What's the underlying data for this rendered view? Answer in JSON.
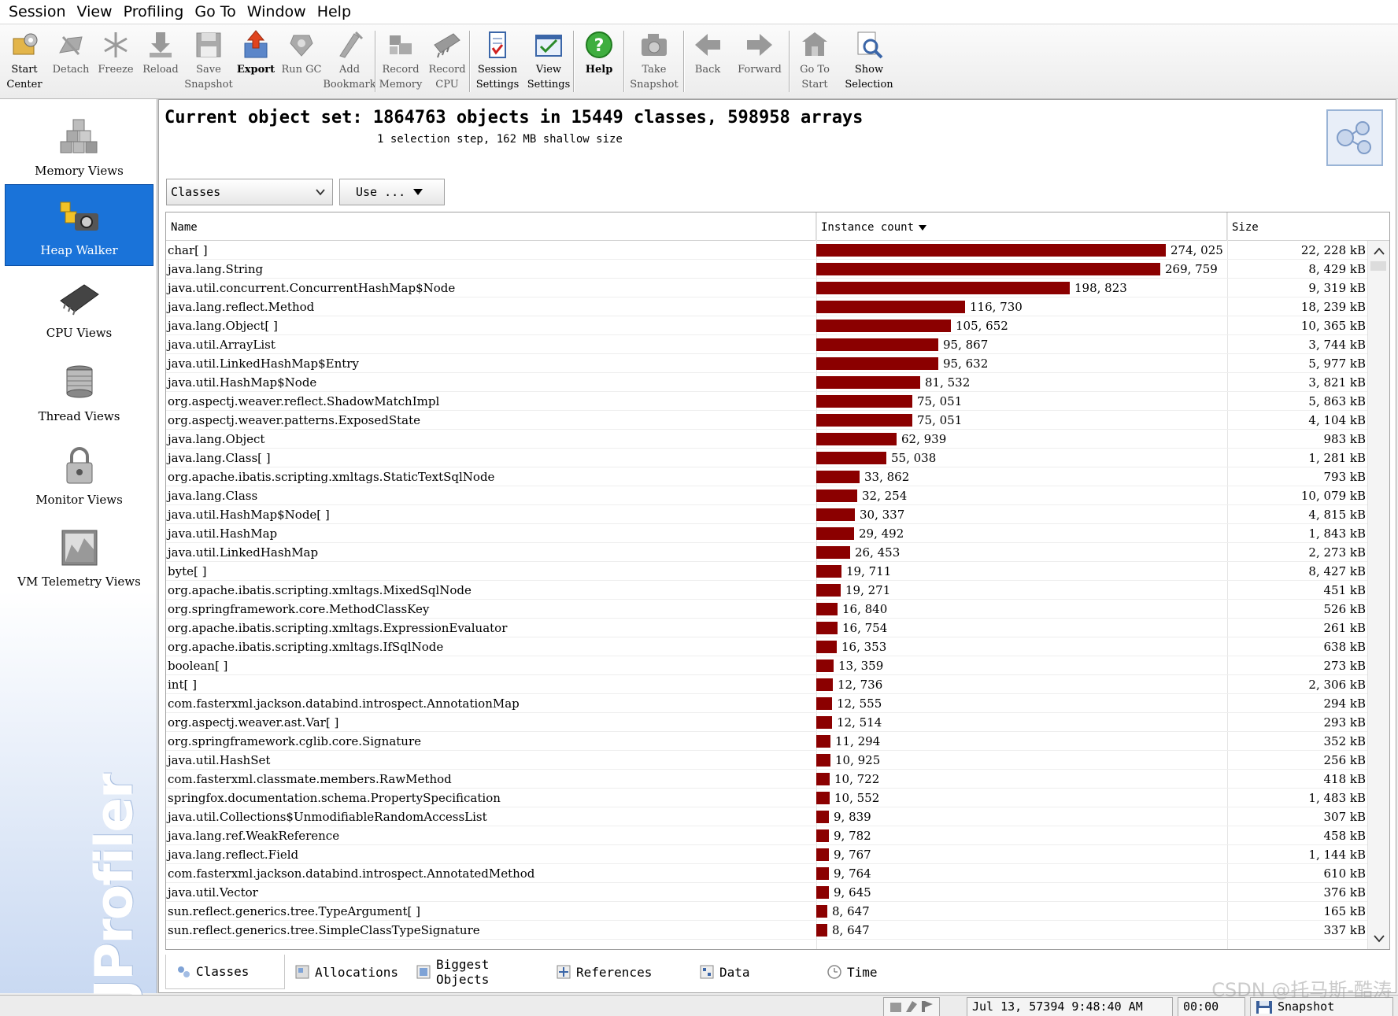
{
  "menu": [
    "Session",
    "View",
    "Profiling",
    "Go To",
    "Window",
    "Help"
  ],
  "toolbar": [
    {
      "id": "start-center",
      "label": "Start\nCenter",
      "style": "darknb",
      "icon": "start-center-icon"
    },
    {
      "id": "detach",
      "label": "Detach",
      "style": "",
      "icon": "detach-icon"
    },
    {
      "id": "freeze",
      "label": "Freeze",
      "style": "",
      "icon": "freeze-icon"
    },
    {
      "id": "reload",
      "label": "Reload",
      "style": "",
      "icon": "reload-icon"
    },
    {
      "id": "save-snapshot",
      "label": "Save\nSnapshot",
      "style": "",
      "icon": "save-icon"
    },
    {
      "id": "export",
      "label": "Export",
      "style": "dark",
      "icon": "export-icon"
    },
    {
      "id": "run-gc",
      "label": "Run GC",
      "style": "",
      "icon": "run-gc-icon"
    },
    {
      "id": "add-bookmark",
      "label": "Add\nBookmark",
      "style": "",
      "icon": "bookmark-icon",
      "sep_after": true
    },
    {
      "id": "record-memory",
      "label": "Record\nMemory",
      "style": "",
      "icon": "record-memory-icon"
    },
    {
      "id": "record-cpu",
      "label": "Record\nCPU",
      "style": "",
      "icon": "record-cpu-icon",
      "sep_after": true
    },
    {
      "id": "session-settings",
      "label": "Session\nSettings",
      "style": "darknb",
      "icon": "session-settings-icon"
    },
    {
      "id": "view-settings",
      "label": "View\nSettings",
      "style": "darknb",
      "icon": "view-settings-icon",
      "sep_after": true
    },
    {
      "id": "help",
      "label": "Help",
      "style": "dark",
      "icon": "help-icon",
      "sep_after": true
    },
    {
      "id": "take-snapshot",
      "label": "Take\nSnapshot",
      "style": "",
      "icon": "camera-icon",
      "sep_after": true
    },
    {
      "id": "back",
      "label": "Back",
      "style": "",
      "icon": "back-arrow-icon"
    },
    {
      "id": "forward",
      "label": "Forward",
      "style": "",
      "icon": "forward-arrow-icon",
      "sep_after": true
    },
    {
      "id": "go-to-start",
      "label": "Go To\nStart",
      "style": "",
      "icon": "go-to-start-icon"
    },
    {
      "id": "show-selection",
      "label": "Show\nSelection",
      "style": "darknb",
      "icon": "show-selection-icon"
    }
  ],
  "sidebar": [
    {
      "id": "memory-views",
      "label": "Memory Views",
      "icon": "memory-views-icon",
      "active": false
    },
    {
      "id": "heap-walker",
      "label": "Heap Walker",
      "icon": "heap-walker-icon",
      "active": true
    },
    {
      "id": "cpu-views",
      "label": "CPU Views",
      "icon": "cpu-chip-icon",
      "active": false
    },
    {
      "id": "thread-views",
      "label": "Thread Views",
      "icon": "thread-spool-icon",
      "active": false
    },
    {
      "id": "monitor-views",
      "label": "Monitor Views",
      "icon": "lock-icon",
      "active": false
    },
    {
      "id": "vm-telemetry-views",
      "label": "VM Telemetry Views",
      "icon": "telemetry-chart-icon",
      "active": false
    }
  ],
  "logo_text": "JProfiler",
  "header": {
    "title": "Current object set: 1864763 objects in 15449 classes, 598958 arrays",
    "subtitle": "1 selection step, 162 MB shallow size"
  },
  "controls": {
    "view_select": "Classes",
    "use_button": "Use ..."
  },
  "table": {
    "columns": [
      "Name",
      "Instance count",
      "Size"
    ],
    "max_count": 274025,
    "rows": [
      {
        "name": "char[ ]",
        "count": 274025,
        "count_label": "274, 025",
        "size": "22, 228  kB"
      },
      {
        "name": "java.lang.String",
        "count": 269759,
        "count_label": "269, 759",
        "size": "8, 429  kB"
      },
      {
        "name": "java.util.concurrent.ConcurrentHashMap$Node",
        "count": 198823,
        "count_label": "198, 823",
        "size": "9, 319  kB"
      },
      {
        "name": "java.lang.reflect.Method",
        "count": 116730,
        "count_label": "116, 730",
        "size": "18, 239  kB"
      },
      {
        "name": "java.lang.Object[ ]",
        "count": 105652,
        "count_label": "105, 652",
        "size": "10, 365  kB"
      },
      {
        "name": "java.util.ArrayList",
        "count": 95867,
        "count_label": "95, 867",
        "size": "3, 744  kB"
      },
      {
        "name": "java.util.LinkedHashMap$Entry",
        "count": 95632,
        "count_label": "95, 632",
        "size": "5, 977  kB"
      },
      {
        "name": "java.util.HashMap$Node",
        "count": 81532,
        "count_label": "81, 532",
        "size": "3, 821  kB"
      },
      {
        "name": "org.aspectj.weaver.reflect.ShadowMatchImpl",
        "count": 75051,
        "count_label": "75, 051",
        "size": "5, 863  kB"
      },
      {
        "name": "org.aspectj.weaver.patterns.ExposedState",
        "count": 75051,
        "count_label": "75, 051",
        "size": "4, 104  kB"
      },
      {
        "name": "java.lang.Object",
        "count": 62939,
        "count_label": "62, 939",
        "size": "983  kB"
      },
      {
        "name": "java.lang.Class[ ]",
        "count": 55038,
        "count_label": "55, 038",
        "size": "1, 281  kB"
      },
      {
        "name": "org.apache.ibatis.scripting.xmltags.StaticTextSqlNode",
        "count": 33862,
        "count_label": "33, 862",
        "size": "793  kB"
      },
      {
        "name": "java.lang.Class",
        "count": 32254,
        "count_label": "32, 254",
        "size": "10, 079  kB"
      },
      {
        "name": "java.util.HashMap$Node[ ]",
        "count": 30337,
        "count_label": "30, 337",
        "size": "4, 815  kB"
      },
      {
        "name": "java.util.HashMap",
        "count": 29492,
        "count_label": "29, 492",
        "size": "1, 843  kB"
      },
      {
        "name": "java.util.LinkedHashMap",
        "count": 26453,
        "count_label": "26, 453",
        "size": "2, 273  kB"
      },
      {
        "name": "byte[ ]",
        "count": 19711,
        "count_label": "19, 711",
        "size": "8, 427  kB"
      },
      {
        "name": "org.apache.ibatis.scripting.xmltags.MixedSqlNode",
        "count": 19271,
        "count_label": "19, 271",
        "size": "451  kB"
      },
      {
        "name": "org.springframework.core.MethodClassKey",
        "count": 16840,
        "count_label": "16, 840",
        "size": "526  kB"
      },
      {
        "name": "org.apache.ibatis.scripting.xmltags.ExpressionEvaluator",
        "count": 16754,
        "count_label": "16, 754",
        "size": "261  kB"
      },
      {
        "name": "org.apache.ibatis.scripting.xmltags.IfSqlNode",
        "count": 16353,
        "count_label": "16, 353",
        "size": "638  kB"
      },
      {
        "name": "boolean[ ]",
        "count": 13359,
        "count_label": "13, 359",
        "size": "273  kB"
      },
      {
        "name": "int[ ]",
        "count": 12736,
        "count_label": "12, 736",
        "size": "2, 306  kB"
      },
      {
        "name": "com.fasterxml.jackson.databind.introspect.AnnotationMap",
        "count": 12555,
        "count_label": "12, 555",
        "size": "294  kB"
      },
      {
        "name": "org.aspectj.weaver.ast.Var[ ]",
        "count": 12514,
        "count_label": "12, 514",
        "size": "293  kB"
      },
      {
        "name": "org.springframework.cglib.core.Signature",
        "count": 11294,
        "count_label": "11, 294",
        "size": "352  kB"
      },
      {
        "name": "java.util.HashSet",
        "count": 10925,
        "count_label": "10, 925",
        "size": "256  kB"
      },
      {
        "name": "com.fasterxml.classmate.members.RawMethod",
        "count": 10722,
        "count_label": "10, 722",
        "size": "418  kB"
      },
      {
        "name": "springfox.documentation.schema.PropertySpecification",
        "count": 10552,
        "count_label": "10, 552",
        "size": "1, 483  kB"
      },
      {
        "name": "java.util.Collections$UnmodifiableRandomAccessList",
        "count": 9839,
        "count_label": "9, 839",
        "size": "307  kB"
      },
      {
        "name": "java.lang.ref.WeakReference",
        "count": 9782,
        "count_label": "9, 782",
        "size": "458  kB"
      },
      {
        "name": "java.lang.reflect.Field",
        "count": 9767,
        "count_label": "9, 767",
        "size": "1, 144  kB"
      },
      {
        "name": "com.fasterxml.jackson.databind.introspect.AnnotatedMethod",
        "count": 9764,
        "count_label": "9, 764",
        "size": "610  kB"
      },
      {
        "name": "java.util.Vector",
        "count": 9645,
        "count_label": "9, 645",
        "size": "376  kB"
      },
      {
        "name": "sun.reflect.generics.tree.TypeArgument[ ]",
        "count": 8647,
        "count_label": "8, 647",
        "size": "165  kB"
      },
      {
        "name": "sun.reflect.generics.tree.SimpleClassTypeSignature",
        "count": 8647,
        "count_label": "8, 647",
        "size": "337  kB"
      }
    ]
  },
  "bottom_tabs": [
    {
      "id": "classes",
      "label": "Classes",
      "icon": "classes-tab-icon",
      "active": true
    },
    {
      "id": "allocations",
      "label": "Allocations",
      "icon": "allocations-tab-icon",
      "active": false
    },
    {
      "id": "biggest-objects",
      "label": "Biggest Objects",
      "icon": "biggest-objects-tab-icon",
      "active": false
    },
    {
      "id": "references",
      "label": "References",
      "icon": "references-tab-icon",
      "active": false
    },
    {
      "id": "data",
      "label": "Data",
      "icon": "data-tab-icon",
      "active": false
    },
    {
      "id": "time",
      "label": "Time",
      "icon": "time-tab-icon",
      "active": false
    }
  ],
  "status": {
    "datetime": "Jul 13, 57394 9:48:40 AM",
    "elapsed": "00:00",
    "mode": "Snapshot"
  },
  "watermark": "CSDN @托马斯-酷涛",
  "colors": {
    "bar": "#8b0000",
    "active_sidebar": "#1a73d9"
  }
}
